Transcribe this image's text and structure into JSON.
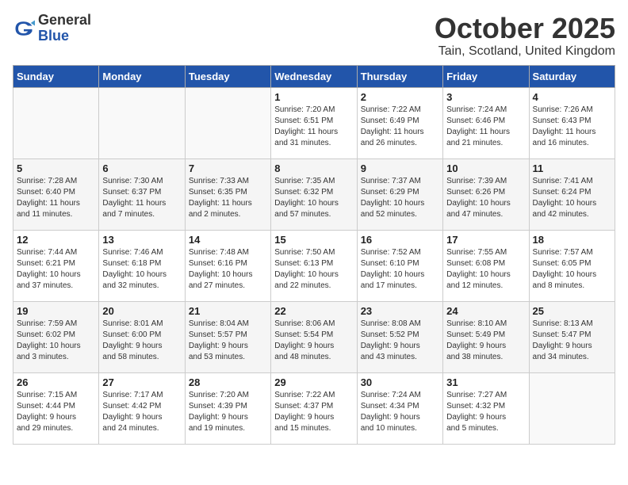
{
  "logo": {
    "general": "General",
    "blue": "Blue"
  },
  "header": {
    "month": "October 2025",
    "location": "Tain, Scotland, United Kingdom"
  },
  "days_of_week": [
    "Sunday",
    "Monday",
    "Tuesday",
    "Wednesday",
    "Thursday",
    "Friday",
    "Saturday"
  ],
  "weeks": [
    [
      {
        "day": "",
        "info": ""
      },
      {
        "day": "",
        "info": ""
      },
      {
        "day": "",
        "info": ""
      },
      {
        "day": "1",
        "info": "Sunrise: 7:20 AM\nSunset: 6:51 PM\nDaylight: 11 hours\nand 31 minutes."
      },
      {
        "day": "2",
        "info": "Sunrise: 7:22 AM\nSunset: 6:49 PM\nDaylight: 11 hours\nand 26 minutes."
      },
      {
        "day": "3",
        "info": "Sunrise: 7:24 AM\nSunset: 6:46 PM\nDaylight: 11 hours\nand 21 minutes."
      },
      {
        "day": "4",
        "info": "Sunrise: 7:26 AM\nSunset: 6:43 PM\nDaylight: 11 hours\nand 16 minutes."
      }
    ],
    [
      {
        "day": "5",
        "info": "Sunrise: 7:28 AM\nSunset: 6:40 PM\nDaylight: 11 hours\nand 11 minutes."
      },
      {
        "day": "6",
        "info": "Sunrise: 7:30 AM\nSunset: 6:37 PM\nDaylight: 11 hours\nand 7 minutes."
      },
      {
        "day": "7",
        "info": "Sunrise: 7:33 AM\nSunset: 6:35 PM\nDaylight: 11 hours\nand 2 minutes."
      },
      {
        "day": "8",
        "info": "Sunrise: 7:35 AM\nSunset: 6:32 PM\nDaylight: 10 hours\nand 57 minutes."
      },
      {
        "day": "9",
        "info": "Sunrise: 7:37 AM\nSunset: 6:29 PM\nDaylight: 10 hours\nand 52 minutes."
      },
      {
        "day": "10",
        "info": "Sunrise: 7:39 AM\nSunset: 6:26 PM\nDaylight: 10 hours\nand 47 minutes."
      },
      {
        "day": "11",
        "info": "Sunrise: 7:41 AM\nSunset: 6:24 PM\nDaylight: 10 hours\nand 42 minutes."
      }
    ],
    [
      {
        "day": "12",
        "info": "Sunrise: 7:44 AM\nSunset: 6:21 PM\nDaylight: 10 hours\nand 37 minutes."
      },
      {
        "day": "13",
        "info": "Sunrise: 7:46 AM\nSunset: 6:18 PM\nDaylight: 10 hours\nand 32 minutes."
      },
      {
        "day": "14",
        "info": "Sunrise: 7:48 AM\nSunset: 6:16 PM\nDaylight: 10 hours\nand 27 minutes."
      },
      {
        "day": "15",
        "info": "Sunrise: 7:50 AM\nSunset: 6:13 PM\nDaylight: 10 hours\nand 22 minutes."
      },
      {
        "day": "16",
        "info": "Sunrise: 7:52 AM\nSunset: 6:10 PM\nDaylight: 10 hours\nand 17 minutes."
      },
      {
        "day": "17",
        "info": "Sunrise: 7:55 AM\nSunset: 6:08 PM\nDaylight: 10 hours\nand 12 minutes."
      },
      {
        "day": "18",
        "info": "Sunrise: 7:57 AM\nSunset: 6:05 PM\nDaylight: 10 hours\nand 8 minutes."
      }
    ],
    [
      {
        "day": "19",
        "info": "Sunrise: 7:59 AM\nSunset: 6:02 PM\nDaylight: 10 hours\nand 3 minutes."
      },
      {
        "day": "20",
        "info": "Sunrise: 8:01 AM\nSunset: 6:00 PM\nDaylight: 9 hours\nand 58 minutes."
      },
      {
        "day": "21",
        "info": "Sunrise: 8:04 AM\nSunset: 5:57 PM\nDaylight: 9 hours\nand 53 minutes."
      },
      {
        "day": "22",
        "info": "Sunrise: 8:06 AM\nSunset: 5:54 PM\nDaylight: 9 hours\nand 48 minutes."
      },
      {
        "day": "23",
        "info": "Sunrise: 8:08 AM\nSunset: 5:52 PM\nDaylight: 9 hours\nand 43 minutes."
      },
      {
        "day": "24",
        "info": "Sunrise: 8:10 AM\nSunset: 5:49 PM\nDaylight: 9 hours\nand 38 minutes."
      },
      {
        "day": "25",
        "info": "Sunrise: 8:13 AM\nSunset: 5:47 PM\nDaylight: 9 hours\nand 34 minutes."
      }
    ],
    [
      {
        "day": "26",
        "info": "Sunrise: 7:15 AM\nSunset: 4:44 PM\nDaylight: 9 hours\nand 29 minutes."
      },
      {
        "day": "27",
        "info": "Sunrise: 7:17 AM\nSunset: 4:42 PM\nDaylight: 9 hours\nand 24 minutes."
      },
      {
        "day": "28",
        "info": "Sunrise: 7:20 AM\nSunset: 4:39 PM\nDaylight: 9 hours\nand 19 minutes."
      },
      {
        "day": "29",
        "info": "Sunrise: 7:22 AM\nSunset: 4:37 PM\nDaylight: 9 hours\nand 15 minutes."
      },
      {
        "day": "30",
        "info": "Sunrise: 7:24 AM\nSunset: 4:34 PM\nDaylight: 9 hours\nand 10 minutes."
      },
      {
        "day": "31",
        "info": "Sunrise: 7:27 AM\nSunset: 4:32 PM\nDaylight: 9 hours\nand 5 minutes."
      },
      {
        "day": "",
        "info": ""
      }
    ]
  ]
}
